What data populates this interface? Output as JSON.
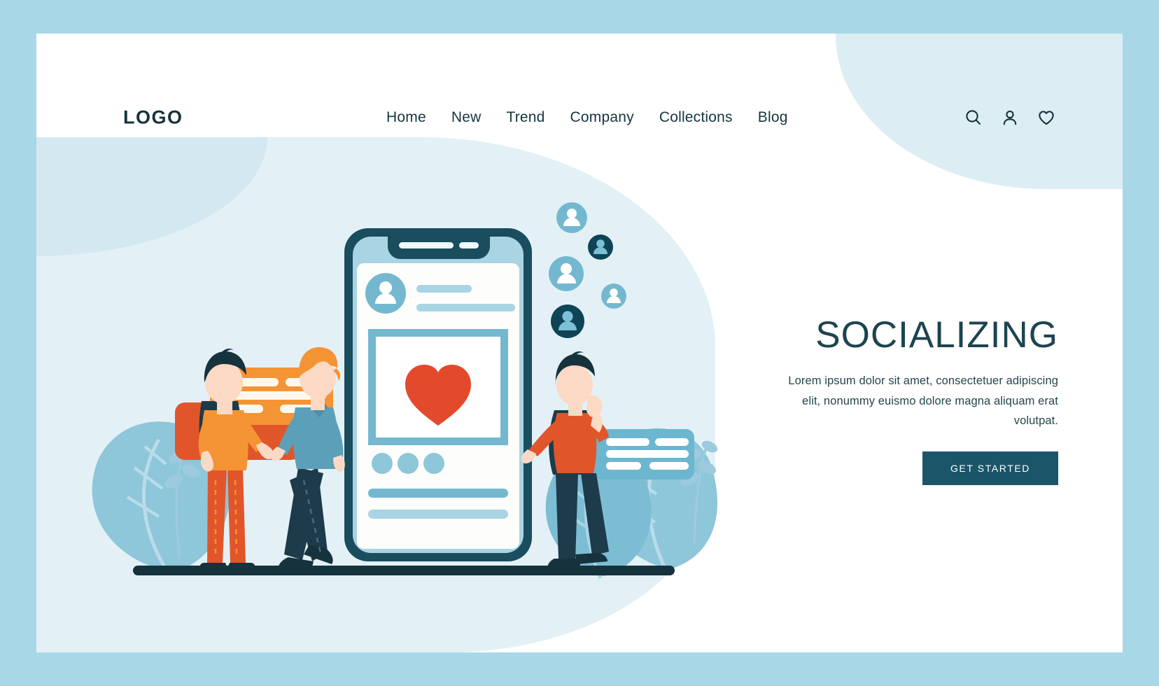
{
  "brand": {
    "logo": "LOGO"
  },
  "nav": {
    "items": [
      {
        "label": "Home"
      },
      {
        "label": "New"
      },
      {
        "label": "Trend"
      },
      {
        "label": "Company"
      },
      {
        "label": "Collections"
      },
      {
        "label": "Blog"
      }
    ]
  },
  "header_icons": [
    {
      "name": "search-icon"
    },
    {
      "name": "user-icon"
    },
    {
      "name": "heart-icon"
    }
  ],
  "hero": {
    "title": "SOCIALIZING",
    "paragraph": "Lorem ipsum dolor sit amet, consectetuer adipiscing elit, nonummy euismo dolore magna aliquam erat volutpat.",
    "cta_label": "GET STARTED"
  },
  "illustration": {
    "name": "socializing-illustration",
    "elements": [
      "phone-mockup",
      "heart-post",
      "orange-chat-bubble",
      "blue-chat-bubble",
      "avatar-bubbles",
      "person-left-woman",
      "person-man",
      "person-right-woman",
      "leaf-decorations",
      "ground-line"
    ]
  },
  "colors": {
    "page_border": "#a8d8e8",
    "card_bg": "#ffffff",
    "blob_light": "#e3f1f6",
    "blob_top": "#dceef4",
    "dark_teal": "#1a4d5e",
    "deep_teal": "#16323c",
    "mid_blue": "#6cb6cf",
    "light_blue": "#a9d4e4",
    "pale_blue": "#c9e4ef",
    "orange": "#f59434",
    "orange_dark": "#e1552a",
    "red": "#e34a2b",
    "skin": "#fbd9c4",
    "navy": "#1d3b4a",
    "cta_bg": "#1a5569"
  }
}
